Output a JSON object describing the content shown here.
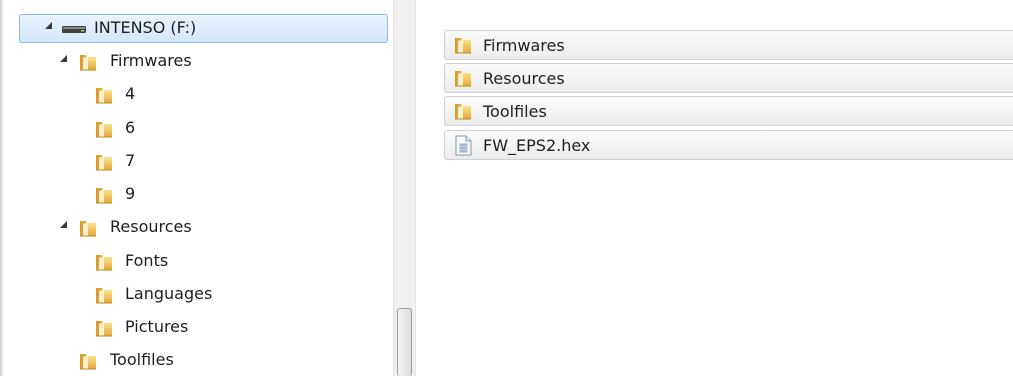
{
  "nav_tree": {
    "drive": {
      "label": "INTENSO (F:)",
      "icon": "drive-icon"
    },
    "items": [
      {
        "label": "Firmwares"
      },
      {
        "label": "4"
      },
      {
        "label": "6"
      },
      {
        "label": "7"
      },
      {
        "label": "9"
      },
      {
        "label": "Resources"
      },
      {
        "label": "Fonts"
      },
      {
        "label": "Languages"
      },
      {
        "label": "Pictures"
      },
      {
        "label": "Toolfiles"
      }
    ]
  },
  "content": {
    "files": [
      {
        "label": "Firmwares",
        "icon": "folder-icon"
      },
      {
        "label": "Resources",
        "icon": "folder-icon"
      },
      {
        "label": "Toolfiles",
        "icon": "folder-icon"
      },
      {
        "label": "FW_EPS2.hex",
        "icon": "file-icon"
      }
    ]
  },
  "colors": {
    "selection_border": "#8fb8e6",
    "selection_fill": "#d4e6fb",
    "folder_yellow": "#f2c94c"
  }
}
